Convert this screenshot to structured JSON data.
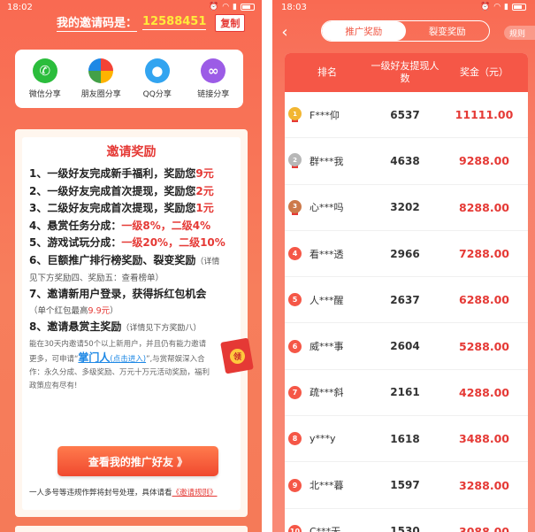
{
  "left": {
    "status": {
      "time": "18:02"
    },
    "invite": {
      "label": "我的邀请码是：",
      "code": "12588451",
      "copy_label": "复制"
    },
    "share": [
      {
        "label": "微信分享",
        "icon": "wechat-icon",
        "glyph": "✆"
      },
      {
        "label": "朋友圈分享",
        "icon": "moments-icon",
        "glyph": ""
      },
      {
        "label": "QQ分享",
        "icon": "qq-icon",
        "glyph": "●"
      },
      {
        "label": "链接分享",
        "icon": "link-icon",
        "glyph": "∞"
      }
    ],
    "reward": {
      "title": "邀请奖励",
      "l1a": "1、一级好友完成新手福利，奖励您",
      "l1b": "9元",
      "l2a": "2、一级好友完成首次提现，奖励您",
      "l2b": "2元",
      "l3a": "3、二级好友完成首次提现，奖励您",
      "l3b": "1元",
      "l4a": "4、悬赏任务分成：",
      "l4b": "一级8%，二级4%",
      "l5a": "5、游戏试玩分成：",
      "l5b": "一级20%，二级10%",
      "l6a": "6、巨额推广排行榜奖励、裂变奖励",
      "l6b": "（详情",
      "l6c": "见下方奖励四、奖励五：查看榜单）",
      "l7": "7、邀请新用户登录，获得拆红包机会",
      "l7na": "（单个红包最高",
      "l7nb": "9.9元",
      "l7nc": "）",
      "l8a": "8、邀请悬赏主奖励",
      "l8b": "（详情见下方奖励八）",
      "p1": "能在30天内邀请50个以上新用户，并且仍有能力邀请",
      "p2a": "更多，可申请“",
      "p2b": "掌门人",
      "p2c": "(点击进入)",
      "p2d": "”,与赏帮娱深入合",
      "p3": "作：永久分成、多级奖励、万元十万元活动奖励，福利",
      "p4": "政策应有尽有!",
      "button": "查看我的推广好友 》",
      "fn_a": "一人多号等违规作弊将封号处理，具体请看",
      "fn_b": "《邀请规则》",
      "packet_label": "领"
    }
  },
  "right": {
    "status": {
      "time": "18:03"
    },
    "tabs": [
      {
        "label": "推广奖励"
      },
      {
        "label": "裂变奖励"
      }
    ],
    "rules_label": "规则",
    "headers": {
      "rank": "排名",
      "count": "一级好友提现人数",
      "amount": "奖金（元）"
    },
    "rows": [
      {
        "rank": "1",
        "name": "F***仰",
        "count": "6537",
        "amount": "11111.00"
      },
      {
        "rank": "2",
        "name": "群***我",
        "count": "4638",
        "amount": "9288.00"
      },
      {
        "rank": "3",
        "name": "心***吗",
        "count": "3202",
        "amount": "8288.00"
      },
      {
        "rank": "4",
        "name": "看***透",
        "count": "2966",
        "amount": "7288.00"
      },
      {
        "rank": "5",
        "name": "人***醒",
        "count": "2637",
        "amount": "6288.00"
      },
      {
        "rank": "6",
        "name": "威***事",
        "count": "2604",
        "amount": "5288.00"
      },
      {
        "rank": "7",
        "name": "疏***斜",
        "count": "2161",
        "amount": "4288.00"
      },
      {
        "rank": "8",
        "name": "y***y",
        "count": "1618",
        "amount": "3488.00"
      },
      {
        "rank": "9",
        "name": "北***暮",
        "count": "1597",
        "amount": "3288.00"
      },
      {
        "rank": "10",
        "name": "C***无",
        "count": "1530",
        "amount": "3088.00"
      }
    ]
  }
}
